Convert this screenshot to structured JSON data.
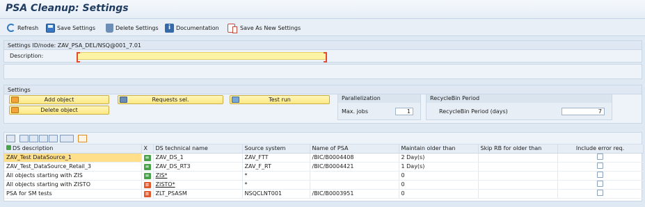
{
  "title": "PSA Cleanup: Settings",
  "toolbar": {
    "refresh": "Refresh",
    "save": "Save Settings",
    "delete": "Delete Settings",
    "documentation": "Documentation",
    "save_as_new": "Save As New Settings"
  },
  "settings_node": {
    "label": "Settings ID/node: ZAV_PSA_DEL/NSQ@001_7.01",
    "description_label": "Description:",
    "description_value": ""
  },
  "settings": {
    "header": "Settings",
    "add_object": "Add object",
    "delete_object": "Delete object",
    "requests_sel": "Requests sel.",
    "test_run": "Test run",
    "parallelization": {
      "header": "Parallelization",
      "max_jobs_label": "Max. jobs",
      "max_jobs_value": "1"
    },
    "recycle": {
      "header": "RecycleBin Period",
      "label": "RecycleBin Period (days)",
      "value": "7"
    }
  },
  "table": {
    "columns": [
      "DS description",
      "X",
      "DS technical name",
      "Source system",
      "Name of PSA",
      "Maintain older than",
      "Skip RB for older than",
      "Include error req."
    ],
    "rows": [
      {
        "desc": "ZAV_Test DataSource_1",
        "x": "green",
        "tech": "ZAV_DS_1",
        "src": "ZAV_FTT",
        "psa": "/BIC/B0004408",
        "maint": "2 Day(s)",
        "skip": "",
        "err": false
      },
      {
        "desc": "ZAV_Test_DataSource_Retail_3",
        "x": "green",
        "tech": "ZAV_DS_RT3",
        "src": "ZAV_F_RT",
        "psa": "/BIC/B0004421",
        "maint": "1 Day(s)",
        "skip": "",
        "err": false
      },
      {
        "desc": "All objects starting with ZIS",
        "x": "green",
        "tech": "ZIS*",
        "src": "*",
        "psa": "",
        "maint": "0",
        "skip": "",
        "err": false
      },
      {
        "desc": "All objects starting with ZISTO",
        "x": "red",
        "tech": "ZISTO*",
        "src": "*",
        "psa": "",
        "maint": "0",
        "skip": "",
        "err": false
      },
      {
        "desc": "PSA for SM tests",
        "x": "red",
        "tech": "ZLT_PSASM",
        "src": "NSQCLNT001",
        "psa": "/BIC/B0003951",
        "maint": "0",
        "skip": "",
        "err": false
      }
    ]
  }
}
